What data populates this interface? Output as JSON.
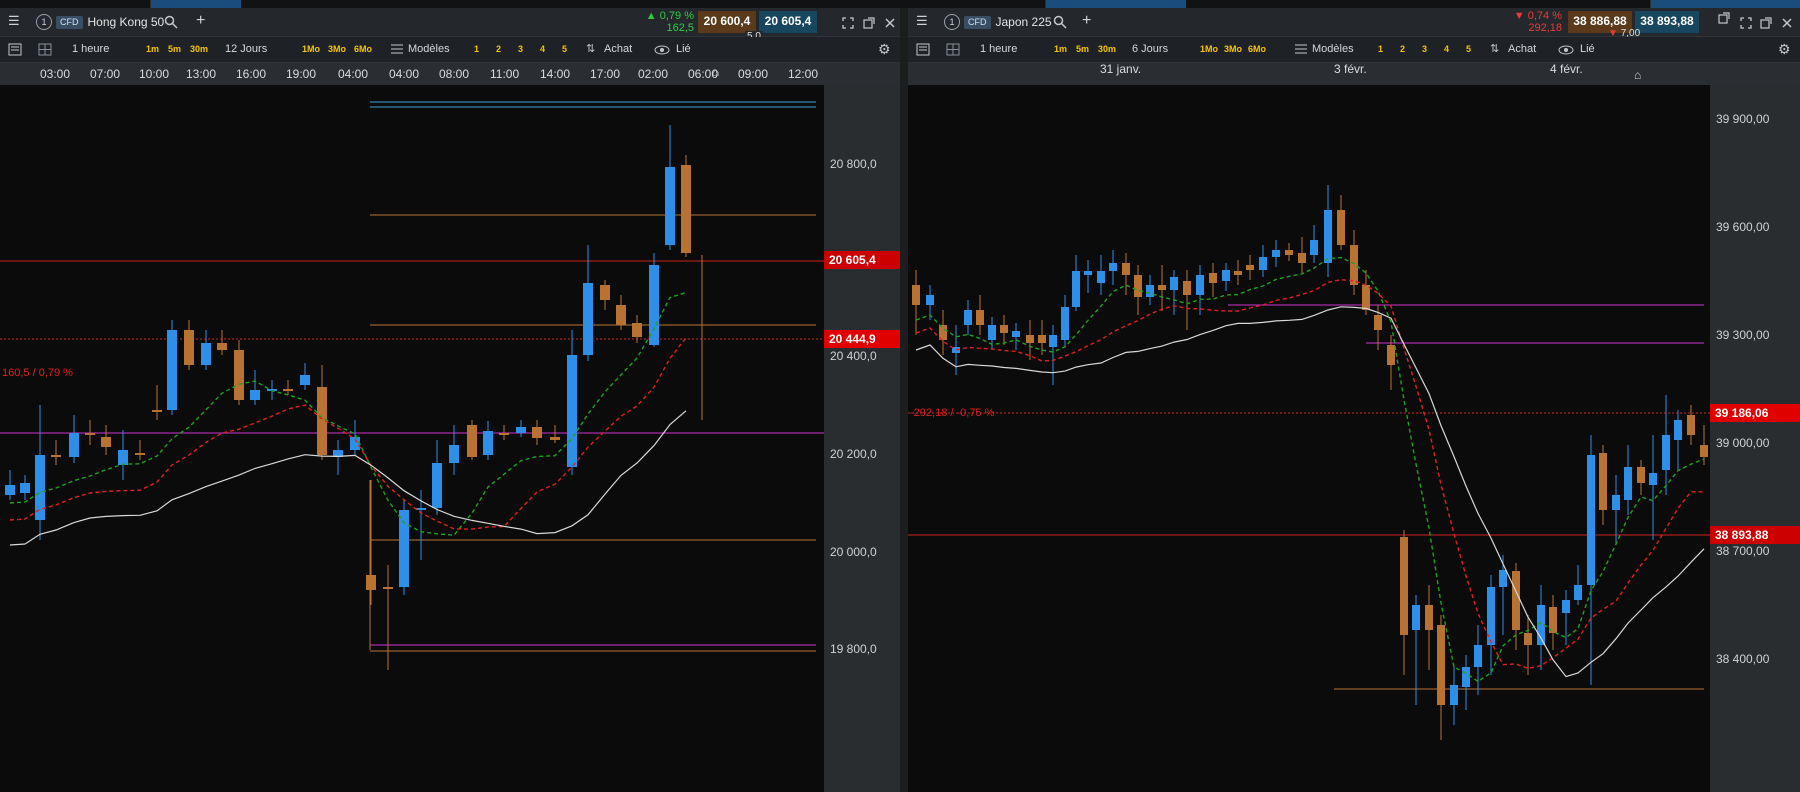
{
  "left": {
    "window_number": "1",
    "badge": "CFD",
    "instrument": "Hong Kong 50",
    "add_tab": "+",
    "change_pct": "▲ 0,79 %",
    "change_abs": "162,5",
    "bid": "20 600,4",
    "ask": "20 605,4",
    "spread": "5,0",
    "interval": "1 heure",
    "quick_intervals": [
      "1m",
      "5m",
      "30m"
    ],
    "range": "12 Jours",
    "quick_ranges": [
      "1Mo",
      "3Mo",
      "6Mo"
    ],
    "templates_label": "Modèles",
    "slots": [
      "1",
      "2",
      "3",
      "4",
      "5"
    ],
    "side_label": "Achat",
    "link_label": "Lié",
    "time_ticks": [
      "03:00",
      "07:00",
      "10:00",
      "13:00",
      "16:00",
      "19:00",
      "04:00",
      "04:00",
      "08:00",
      "11:00",
      "14:00",
      "17:00",
      "02:00",
      "06:00",
      "09:00",
      "12:00"
    ],
    "price_ticks": [
      "20 800,0",
      "20 400,0",
      "20 200,0",
      "20 000,0",
      "19 800,0"
    ],
    "current_price_tag": "20 605,4",
    "prev_close_tag": "20 444,9",
    "prev_close_annotation": "160,5 / 0,79 %",
    "colors": {
      "up": "#2e8fe8",
      "down": "#b87333",
      "tag": "#cc0000"
    }
  },
  "right": {
    "window_number": "1",
    "badge": "CFD",
    "instrument": "Japon 225",
    "add_tab": "+",
    "change_pct": "▼ 0,74 %",
    "change_abs": "292,18",
    "bid": "38 886,88",
    "ask": "38 893,88",
    "spread": "7,00",
    "interval": "1 heure",
    "quick_intervals": [
      "1m",
      "5m",
      "30m"
    ],
    "range": "6 Jours",
    "quick_ranges": [
      "1Mo",
      "3Mo",
      "6Mo"
    ],
    "templates_label": "Modèles",
    "slots": [
      "1",
      "2",
      "3",
      "4",
      "5"
    ],
    "side_label": "Achat",
    "link_label": "Lié",
    "date_ticks": [
      "31 janv.",
      "3 févr.",
      "4 févr."
    ],
    "price_ticks": [
      "39 900,00",
      "39 600,00",
      "39 300,00",
      "39 000,00",
      "38 700,00",
      "38 400,00"
    ],
    "current_price_tag": "38 893,88",
    "prev_close_tag": "39 186,06",
    "prev_close_annotation": "-292,18 / -0,75 %",
    "colors": {
      "up": "#2e8fe8",
      "down": "#b87333",
      "tag": "#cc0000"
    }
  },
  "icons": {
    "menu": "hamburger-icon",
    "search": "search-icon",
    "settings": "gear-icon",
    "eye": "eye-icon",
    "layout": "grid-layout-icon",
    "templates": "templates-icon",
    "close": "close-icon",
    "expand": "expand-icon",
    "popout": "popout-icon"
  }
}
